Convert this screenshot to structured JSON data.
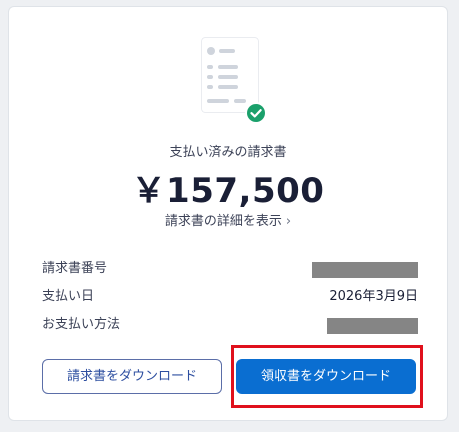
{
  "invoice": {
    "status_label": "支払い済みの請求書",
    "amount": "￥157,500",
    "details_link": "請求書の詳細を表示",
    "details_chevron": "›"
  },
  "details": [
    {
      "key": "請求書番号",
      "value": null,
      "redacted": true
    },
    {
      "key": "支払い日",
      "value": "2026年3月9日",
      "redacted": false
    },
    {
      "key": "お支払い方法",
      "value": null,
      "redacted": true
    }
  ],
  "actions": {
    "download_invoice": "請求書をダウンロード",
    "download_receipt": "領収書をダウンロード"
  },
  "colors": {
    "primary": "#0a6ed1",
    "success": "#1aa06b",
    "highlight": "#e0101c"
  },
  "icons": {
    "document": "document-check-icon",
    "chevron": "chevron-right-icon"
  }
}
